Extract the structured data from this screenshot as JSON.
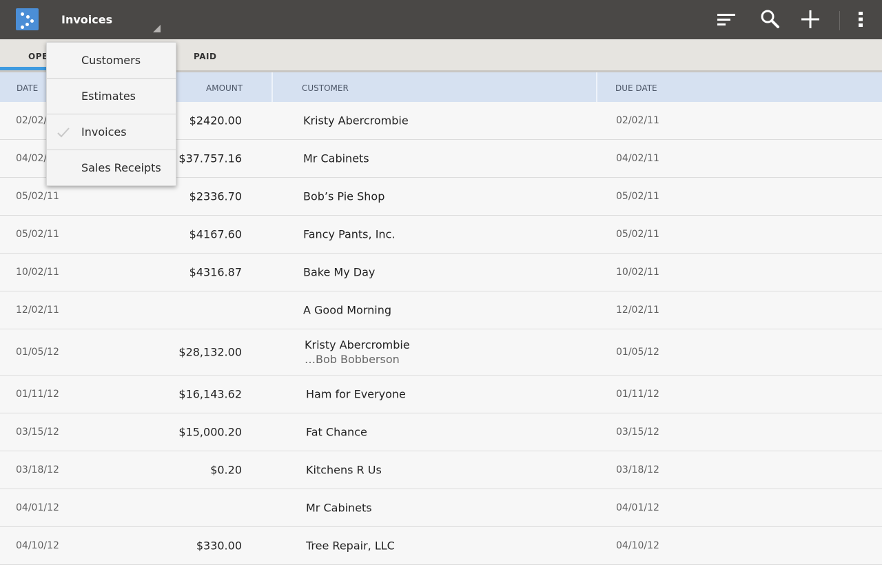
{
  "action_bar": {
    "title": "Invoices",
    "icons": [
      "sort-icon",
      "search-icon",
      "add-icon",
      "overflow-menu-icon"
    ]
  },
  "tabs": [
    {
      "label": "OPEN",
      "selected": true
    },
    {
      "label": "PAID",
      "selected": false
    }
  ],
  "dropdown": {
    "items": [
      {
        "label": "Customers",
        "checked": false
      },
      {
        "label": "Estimates",
        "checked": false
      },
      {
        "label": "Invoices",
        "checked": true
      },
      {
        "label": "Sales Receipts",
        "checked": false
      }
    ]
  },
  "table": {
    "headers": {
      "date": "DATE",
      "amount": "AMOUNT",
      "customer": "CUSTOMER",
      "due_date": "DUE DATE"
    },
    "rows": [
      {
        "date": "02/02/11",
        "amount": "$2420.00",
        "customer": "Kristy Abercrombie",
        "due": "02/02/11"
      },
      {
        "date": "04/02/11",
        "amount": "$37.757.16",
        "customer": "Mr Cabinets",
        "due": "04/02/11"
      },
      {
        "date": "05/02/11",
        "amount": "$2336.70",
        "customer": "Bob’s Pie Shop",
        "due": "05/02/11"
      },
      {
        "date": "05/02/11",
        "amount": "$4167.60",
        "customer": "Fancy Pants, Inc.",
        "due": "05/02/11"
      },
      {
        "date": "10/02/11",
        "amount": "$4316.87",
        "customer": "Bake My Day",
        "due": "10/02/11"
      },
      {
        "date": "12/02/11",
        "amount": "",
        "customer": "A Good Morning",
        "due": "12/02/11"
      },
      {
        "date": "01/05/12",
        "amount": "$28,132.00",
        "customer": "Kristy Abercrombie",
        "customer_sub": "…Bob Bobberson",
        "due": "01/05/12"
      },
      {
        "date": "01/11/12",
        "amount": "$16,143.62",
        "customer": "Ham for Everyone",
        "due": "01/11/12"
      },
      {
        "date": "03/15/12",
        "amount": "$15,000.20",
        "customer": "Fat Chance",
        "due": "03/15/12"
      },
      {
        "date": "03/18/12",
        "amount": "$0.20",
        "customer": "Kitchens R Us",
        "due": "03/18/12"
      },
      {
        "date": "04/01/12",
        "amount": "",
        "customer": "Mr Cabinets",
        "due": "04/01/12"
      },
      {
        "date": "04/10/12",
        "amount": "$330.00",
        "customer": "Tree Repair, LLC",
        "due": "04/10/12"
      }
    ]
  },
  "colors": {
    "action_bar": "#4a4846",
    "accent": "#3f9be0",
    "header": "#d6e1f1",
    "logo": "#4b8ed6"
  }
}
